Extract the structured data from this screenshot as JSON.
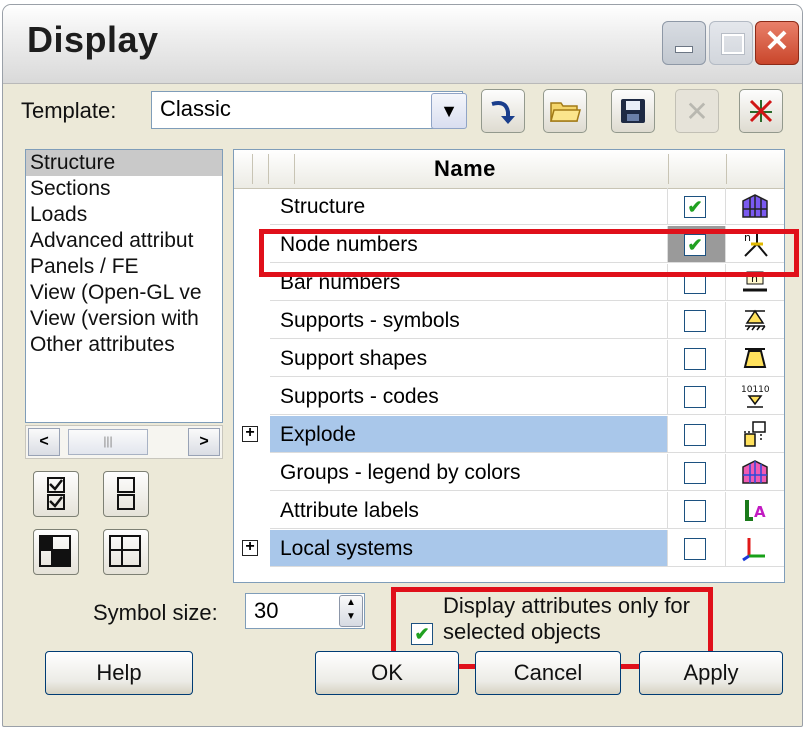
{
  "window": {
    "title": "Display"
  },
  "template": {
    "label": "Template:",
    "value": "Classic"
  },
  "categories": [
    "Structure",
    "Sections",
    "Loads",
    "Advanced attribut",
    "Panels / FE",
    "View (Open-GL ve",
    "View (version with",
    "Other attributes"
  ],
  "grid": {
    "header": "Name",
    "rows": [
      {
        "name": "Structure",
        "checked": true,
        "icon": "structure-icon",
        "expandable": false,
        "highlight": false
      },
      {
        "name": "Node numbers",
        "checked": true,
        "icon": "node-numbers-icon",
        "expandable": false,
        "highlight": false
      },
      {
        "name": "Bar numbers",
        "checked": false,
        "icon": "bar-numbers-icon",
        "expandable": false,
        "highlight": false
      },
      {
        "name": "Supports - symbols",
        "checked": false,
        "icon": "supports-symbols-icon",
        "expandable": false,
        "highlight": false
      },
      {
        "name": "Support shapes",
        "checked": false,
        "icon": "support-shapes-icon",
        "expandable": false,
        "highlight": false
      },
      {
        "name": "Supports - codes",
        "checked": false,
        "icon": "supports-codes-icon",
        "expandable": false,
        "highlight": false
      },
      {
        "name": "Explode",
        "checked": false,
        "icon": "explode-icon",
        "expandable": true,
        "highlight": true
      },
      {
        "name": "Groups - legend by colors",
        "checked": false,
        "icon": "groups-legend-icon",
        "expandable": false,
        "highlight": false
      },
      {
        "name": "Attribute labels",
        "checked": false,
        "icon": "attribute-labels-icon",
        "expandable": false,
        "highlight": false
      },
      {
        "name": "Local systems",
        "checked": false,
        "icon": "local-systems-icon",
        "expandable": true,
        "highlight": true
      }
    ]
  },
  "symbol_size": {
    "label": "Symbol size:",
    "value": "30"
  },
  "display_only_selected": {
    "label_line1": "Display attributes only for",
    "label_line2": "selected objects",
    "checked": true
  },
  "buttons": {
    "help": "Help",
    "ok": "OK",
    "cancel": "Cancel",
    "apply": "Apply"
  },
  "icons_text": {
    "supports_codes": "10110",
    "bar_numbers": "n"
  },
  "colors": {
    "highlight_row": "#a9c7ea",
    "annotation_red": "#e0101a",
    "check_green": "#21a121"
  }
}
